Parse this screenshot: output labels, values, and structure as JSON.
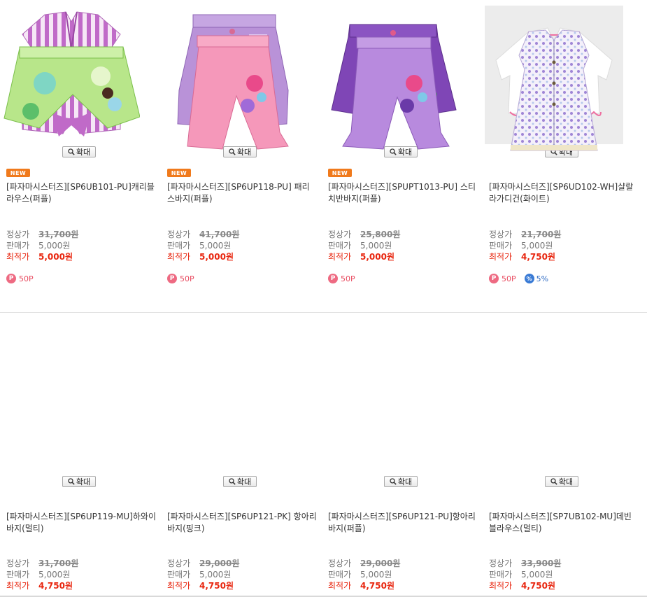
{
  "zoom_label": "확대",
  "new_label": "NEW",
  "labels": {
    "regular": "정상가",
    "sale": "판매가",
    "best": "최적가"
  },
  "colors": {
    "best_price": "#e8260f",
    "new_badge": "#f07a1c",
    "point": "#ee6a82",
    "coupon": "#3a7bd5"
  },
  "products": [
    {
      "name": "[파자마시스터즈][SP6UB101-PU]캐리블라우스(퍼플)",
      "is_new": true,
      "regular_price": "31,700원",
      "sale_price": "5,000원",
      "best_price": "5,000원",
      "point": "50P",
      "image": "purple-stripe-blouse"
    },
    {
      "name": "[파자마시스터즈][SP6UP118-PU] 패리스바지(퍼플)",
      "is_new": true,
      "regular_price": "41,700원",
      "sale_price": "5,000원",
      "best_price": "5,000원",
      "point": "50P",
      "image": "lavender-shorts"
    },
    {
      "name": "[파자마시스터즈][SPUPT1013-PU] 스티치반바지(퍼플)",
      "is_new": true,
      "regular_price": "25,800원",
      "sale_price": "5,000원",
      "best_price": "5,000원",
      "point": "50P",
      "image": "purple-short-shorts"
    },
    {
      "name": "[파자마시스터즈][SP6UD102-WH]샬랄라가디건(화이트)",
      "is_new": false,
      "regular_price": "21,700원",
      "sale_price": "5,000원",
      "best_price": "4,750원",
      "point": "50P",
      "coupon": "5%",
      "image": "white-cardigan"
    },
    {
      "name": "[파자마시스터즈][SP6UP119-MU]하와이바지(멀티)",
      "is_new": false,
      "regular_price": "31,700원",
      "sale_price": "5,000원",
      "best_price": "4,750원",
      "image": "green-floral-shorts"
    },
    {
      "name": "[파자마시스터즈][SP6UP121-PK] 항아리바지(핑크)",
      "is_new": false,
      "regular_price": "29,000원",
      "sale_price": "5,000원",
      "best_price": "4,750원",
      "image": "pink-balloon-pants"
    },
    {
      "name": "[파자마시스터즈][SP6UP121-PU]항아리바지(퍼플)",
      "is_new": false,
      "regular_price": "29,000원",
      "sale_price": "5,000원",
      "best_price": "4,750원",
      "image": "purple-balloon-pants"
    },
    {
      "name": "[파자마시스터즈][SP7UB102-MU]데빈블라우스(멀티)",
      "is_new": false,
      "regular_price": "33,900원",
      "sale_price": "5,000원",
      "best_price": "4,750원",
      "image": "floral-sleeveless-blouse"
    }
  ]
}
